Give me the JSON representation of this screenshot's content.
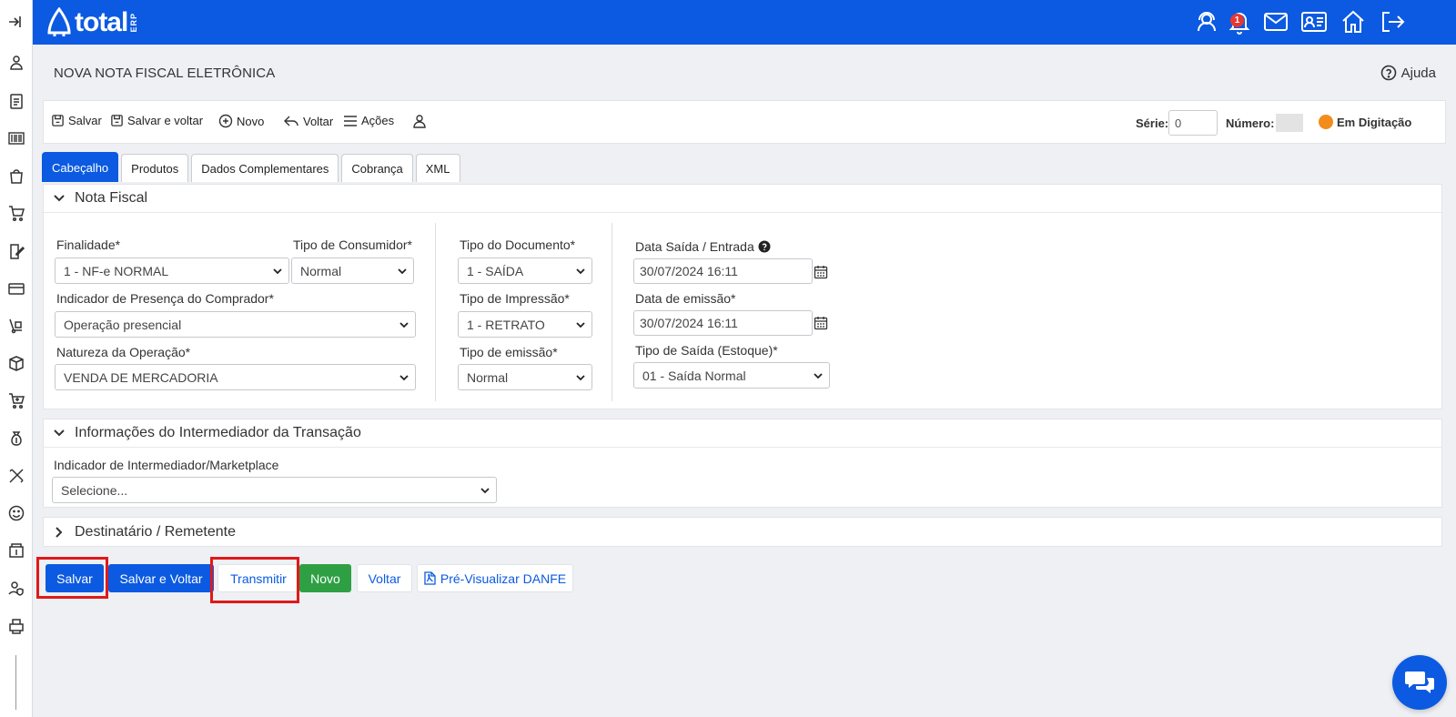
{
  "app": {
    "logo_text": "total",
    "logo_suffix": "ERP"
  },
  "topbar": {
    "notification_count": "1"
  },
  "page": {
    "title": "NOVA NOTA FISCAL ELETRÔNICA",
    "help_label": "Ajuda"
  },
  "toolbar": {
    "save_label": "Salvar",
    "save_back_label": "Salvar e voltar",
    "new_label": "Novo",
    "back_label": "Voltar",
    "actions_label": "Ações",
    "serie_label": "Série:",
    "serie_value": "0",
    "numero_label": "Número:",
    "status_label": "Em Digitação"
  },
  "tabs": [
    "Cabeçalho",
    "Produtos",
    "Dados Complementares",
    "Cobrança",
    "XML"
  ],
  "nota_fiscal": {
    "section_title": "Nota Fiscal",
    "finalidade_label": "Finalidade*",
    "finalidade_value": "1 - NF-e NORMAL",
    "tipo_consumidor_label": "Tipo de Consumidor*",
    "tipo_consumidor_value": "Normal",
    "presenca_label": "Indicador de Presença do Comprador*",
    "presenca_value": "Operação presencial",
    "natureza_label": "Natureza da Operação*",
    "natureza_value": "VENDA DE MERCADORIA",
    "tipo_documento_label": "Tipo do Documento*",
    "tipo_documento_value": "1 - SAÍDA",
    "tipo_impressao_label": "Tipo de Impressão*",
    "tipo_impressao_value": "1 - RETRATO",
    "tipo_emissao_label": "Tipo de emissão*",
    "tipo_emissao_value": "Normal",
    "data_saida_label": "Data Saída / Entrada",
    "data_saida_value": "30/07/2024 16:11",
    "data_emissao_label": "Data de emissão*",
    "data_emissao_value": "30/07/2024 16:11",
    "tipo_saida_label": "Tipo de Saída (Estoque)*",
    "tipo_saida_value": "01 - Saída Normal"
  },
  "intermediador": {
    "section_title": "Informações do Intermediador da Transação",
    "indicador_label": "Indicador de Intermediador/Marketplace",
    "indicador_value": "Selecione..."
  },
  "destinatario": {
    "section_title": "Destinatário / Remetente"
  },
  "actions": {
    "save": "Salvar",
    "save_back": "Salvar e Voltar",
    "transmit": "Transmitir",
    "new": "Novo",
    "back": "Voltar",
    "preview": "Pré-Visualizar DANFE"
  },
  "colors": {
    "primary": "#0b5ae1",
    "success": "#2ea043",
    "status_dot": "#f28c1b",
    "highlight": "#e01919"
  }
}
